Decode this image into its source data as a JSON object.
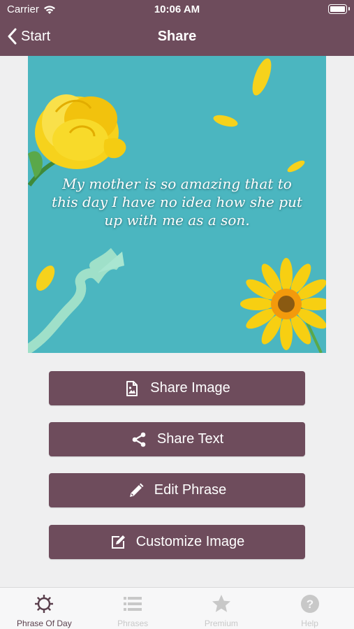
{
  "status": {
    "carrier": "Carrier",
    "time": "10:06 AM"
  },
  "nav": {
    "back_label": "Start",
    "title": "Share"
  },
  "card": {
    "quote": "My mother is so amazing that to this day I have no idea how she put up with me as a son."
  },
  "buttons": {
    "share_image": "Share Image",
    "share_text": "Share Text",
    "edit_phrase": "Edit Phrase",
    "customize_image": "Customize Image"
  },
  "tabs": [
    {
      "label": "Phrase Of Day",
      "icon": "sun-gear-icon",
      "active": true
    },
    {
      "label": "Phrases",
      "icon": "list-icon",
      "active": false
    },
    {
      "label": "Premium",
      "icon": "star-icon",
      "active": false
    },
    {
      "label": "Help",
      "icon": "help-icon",
      "active": false
    }
  ],
  "colors": {
    "brand": "#6e4c5c",
    "card_bg": "#4bb6c0",
    "tab_active": "#5a3f4c",
    "tab_inactive": "#c8c8c8"
  }
}
